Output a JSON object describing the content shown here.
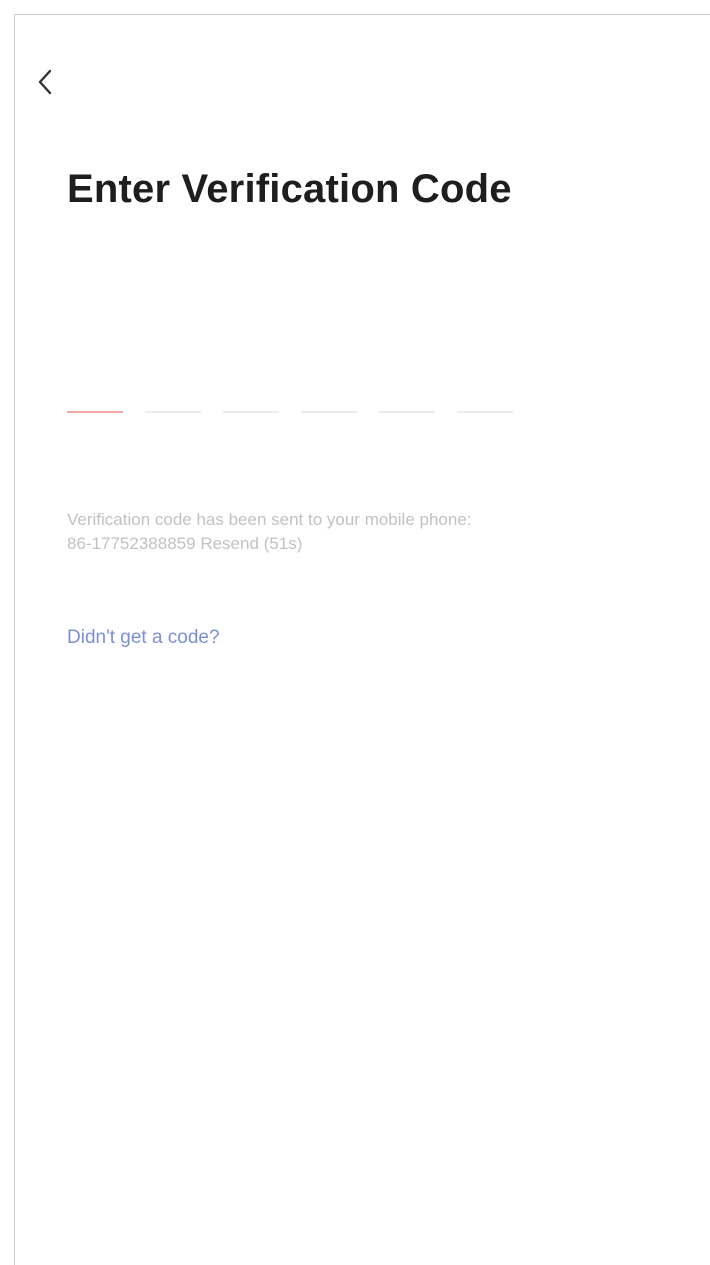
{
  "header": {
    "back_icon": "chevron-left-icon"
  },
  "title": "Enter Verification Code",
  "code_input": {
    "digit_count": 6,
    "active_index": 0,
    "colors": {
      "active": "#f3a9a4",
      "inactive": "#ececec"
    }
  },
  "info": {
    "message": "Verification code has been sent to your mobile phone:",
    "phone": "86-17752388859",
    "resend_label": "Resend (51s)"
  },
  "help_link": "Didn't get a code?",
  "colors": {
    "link": "#7b8fd8",
    "title": "#1e1e1e",
    "muted_text": "#c2c2c2"
  }
}
